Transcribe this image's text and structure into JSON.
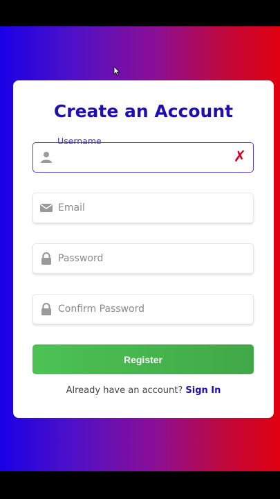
{
  "form": {
    "title": "Create an Account",
    "username": {
      "label": "Username",
      "value": ""
    },
    "email": {
      "placeholder": "Email"
    },
    "password": {
      "placeholder": "Password"
    },
    "confirm": {
      "placeholder": "Confirm Password"
    },
    "register_label": "Register",
    "signin_prompt": "Already have an account?",
    "signin_link": "Sign In",
    "clear_glyph": "✗"
  },
  "colors": {
    "accent": "#1f0fb0",
    "button": "#45b04b",
    "error": "#d4001a",
    "bg_left": "#1a00e6",
    "bg_right": "#e00010"
  },
  "icons": [
    "user-icon",
    "envelope-icon",
    "lock-icon",
    "lock-icon",
    "clear-x-icon",
    "mouse-cursor-icon"
  ]
}
